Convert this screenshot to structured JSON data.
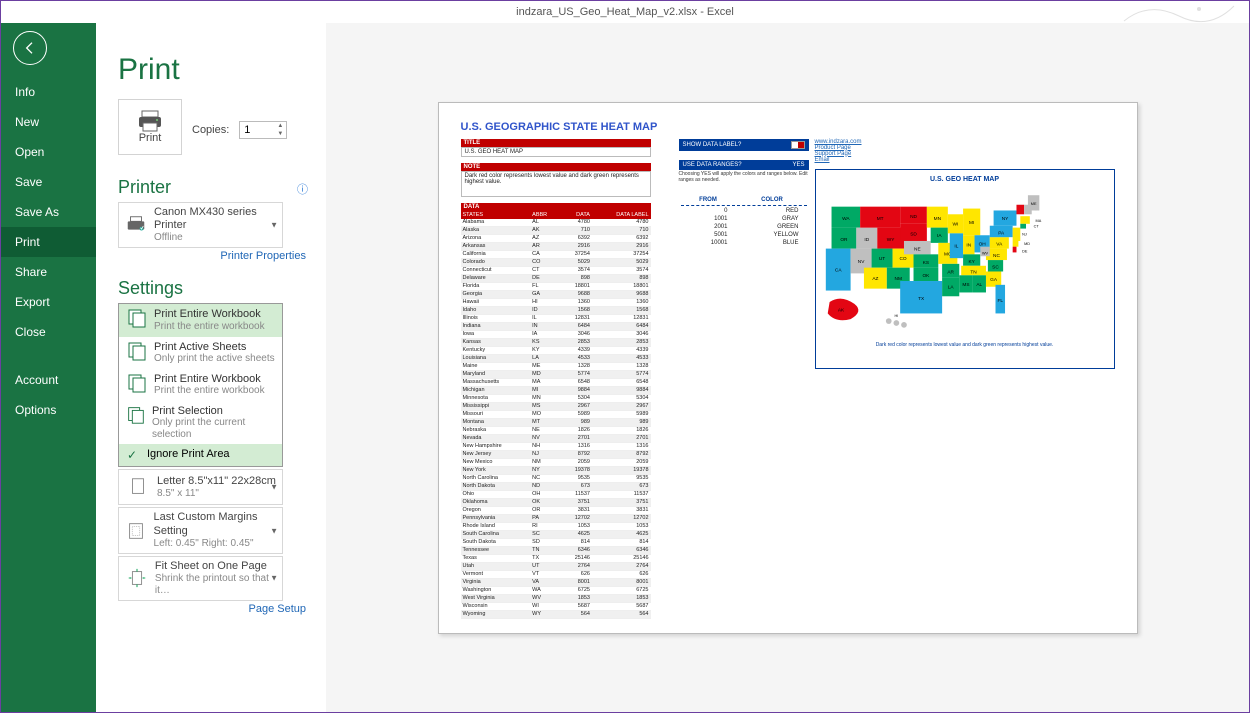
{
  "window": {
    "title": "indzara_US_Geo_Heat_Map_v2.xlsx - Excel"
  },
  "sidebar": {
    "items": [
      "Info",
      "New",
      "Open",
      "Save",
      "Save As",
      "Print",
      "Share",
      "Export",
      "Close",
      "Account",
      "Options"
    ],
    "active": "Print"
  },
  "page": {
    "heading": "Print",
    "print_btn": "Print",
    "copies_label": "Copies:",
    "copies_value": "1"
  },
  "printer": {
    "heading": "Printer",
    "name": "Canon MX430 series Printer",
    "status": "Offline",
    "properties_link": "Printer Properties"
  },
  "settings": {
    "heading": "Settings",
    "what_open": {
      "selected": 0,
      "rows": [
        {
          "title": "Print Entire Workbook",
          "sub": "Print the entire workbook"
        },
        {
          "title": "Print Active Sheets",
          "sub": "Only print the active sheets"
        },
        {
          "title": "Print Entire Workbook",
          "sub": "Print the entire workbook"
        },
        {
          "title": "Print Selection",
          "sub": "Only print the current selection"
        }
      ],
      "ignore": "Ignore Print Area"
    },
    "paper": {
      "title": "Letter 8.5\"x11\" 22x28cm",
      "sub": "8.5\" x 11\""
    },
    "margins": {
      "title": "Last Custom Margins Setting",
      "sub": "Left: 0.45\"   Right: 0.45\""
    },
    "scale": {
      "title": "Fit Sheet on One Page",
      "sub": "Shrink the printout so that it…"
    },
    "page_setup": "Page Setup"
  },
  "preview": {
    "title": "U.S. GEOGRAPHIC STATE HEAT MAP",
    "title_hdr": "TITLE",
    "title_val": "U.S. GEO HEAT MAP",
    "note_hdr": "NOTE",
    "note_val": "Dark red color represents lowest value and dark green represents highest value.",
    "data_hdr": "DATA",
    "cols": [
      "STATES",
      "ABBR",
      "DATA",
      "DATA LABEL"
    ],
    "rows": [
      [
        "Alabama",
        "AL",
        "4780",
        "4780"
      ],
      [
        "Alaska",
        "AK",
        "710",
        "710"
      ],
      [
        "Arizona",
        "AZ",
        "6392",
        "6392"
      ],
      [
        "Arkansas",
        "AR",
        "2916",
        "2916"
      ],
      [
        "California",
        "CA",
        "37254",
        "37254"
      ],
      [
        "Colorado",
        "CO",
        "5029",
        "5029"
      ],
      [
        "Connecticut",
        "CT",
        "3574",
        "3574"
      ],
      [
        "Delaware",
        "DE",
        "898",
        "898"
      ],
      [
        "Florida",
        "FL",
        "18801",
        "18801"
      ],
      [
        "Georgia",
        "GA",
        "9688",
        "9688"
      ],
      [
        "Hawaii",
        "HI",
        "1360",
        "1360"
      ],
      [
        "Idaho",
        "ID",
        "1568",
        "1568"
      ],
      [
        "Illinois",
        "IL",
        "12831",
        "12831"
      ],
      [
        "Indiana",
        "IN",
        "6484",
        "6484"
      ],
      [
        "Iowa",
        "IA",
        "3046",
        "3046"
      ],
      [
        "Kansas",
        "KS",
        "2853",
        "2853"
      ],
      [
        "Kentucky",
        "KY",
        "4339",
        "4339"
      ],
      [
        "Louisiana",
        "LA",
        "4533",
        "4533"
      ],
      [
        "Maine",
        "ME",
        "1328",
        "1328"
      ],
      [
        "Maryland",
        "MD",
        "5774",
        "5774"
      ],
      [
        "Massachusetts",
        "MA",
        "6548",
        "6548"
      ],
      [
        "Michigan",
        "MI",
        "9884",
        "9884"
      ],
      [
        "Minnesota",
        "MN",
        "5304",
        "5304"
      ],
      [
        "Mississippi",
        "MS",
        "2967",
        "2967"
      ],
      [
        "Missouri",
        "MO",
        "5989",
        "5989"
      ],
      [
        "Montana",
        "MT",
        "989",
        "989"
      ],
      [
        "Nebraska",
        "NE",
        "1826",
        "1826"
      ],
      [
        "Nevada",
        "NV",
        "2701",
        "2701"
      ],
      [
        "New Hampshire",
        "NH",
        "1316",
        "1316"
      ],
      [
        "New Jersey",
        "NJ",
        "8792",
        "8792"
      ],
      [
        "New Mexico",
        "NM",
        "2059",
        "2059"
      ],
      [
        "New York",
        "NY",
        "19378",
        "19378"
      ],
      [
        "North Carolina",
        "NC",
        "9535",
        "9535"
      ],
      [
        "North Dakota",
        "ND",
        "673",
        "673"
      ],
      [
        "Ohio",
        "OH",
        "11537",
        "11537"
      ],
      [
        "Oklahoma",
        "OK",
        "3751",
        "3751"
      ],
      [
        "Oregon",
        "OR",
        "3831",
        "3831"
      ],
      [
        "Pennsylvania",
        "PA",
        "12702",
        "12702"
      ],
      [
        "Rhode Island",
        "RI",
        "1053",
        "1053"
      ],
      [
        "South Carolina",
        "SC",
        "4625",
        "4625"
      ],
      [
        "South Dakota",
        "SD",
        "814",
        "814"
      ],
      [
        "Tennessee",
        "TN",
        "6346",
        "6346"
      ],
      [
        "Texas",
        "TX",
        "25146",
        "25146"
      ],
      [
        "Utah",
        "UT",
        "2764",
        "2764"
      ],
      [
        "Vermont",
        "VT",
        "626",
        "626"
      ],
      [
        "Virginia",
        "VA",
        "8001",
        "8001"
      ],
      [
        "Washington",
        "WA",
        "6725",
        "6725"
      ],
      [
        "West Virginia",
        "WV",
        "1853",
        "1853"
      ],
      [
        "Wisconsin",
        "WI",
        "5687",
        "5687"
      ],
      [
        "Wyoming",
        "WY",
        "564",
        "564"
      ]
    ],
    "q1": {
      "label": "SHOW DATA LABEL?",
      "val": ""
    },
    "q2": {
      "label": "USE DATA RANGES?",
      "val": "YES"
    },
    "q2_note": "Choosing YES will apply the colors and ranges below. Edit ranges as needed.",
    "range_hdr": [
      "FROM",
      "COLOR"
    ],
    "ranges": [
      [
        "0",
        "RED"
      ],
      [
        "1001",
        "GRAY"
      ],
      [
        "2001",
        "GREEN"
      ],
      [
        "5001",
        "YELLOW"
      ],
      [
        "10001",
        "BLUE"
      ]
    ],
    "links": [
      "www.indzara.com",
      "Product Page",
      "Support Page",
      "Email"
    ],
    "map_title": "U.S. GEO HEAT MAP",
    "map_note": "Dark red color represents lowest value and dark green represents highest value."
  }
}
